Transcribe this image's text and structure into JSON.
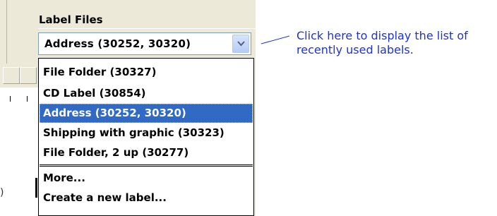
{
  "label_files": {
    "title": "Label Files",
    "current_value": "Address (30252, 30320)"
  },
  "dropdown": {
    "items": [
      "File Folder (30327)",
      "CD Label (30854)",
      "Address (30252, 30320)",
      "Shipping with graphic (30323)",
      "File Folder, 2 up (30277)"
    ],
    "selected_index": 2,
    "actions": [
      "More...",
      "Create a new label..."
    ]
  },
  "callout": {
    "text": "Click here to display the list of recently used labels."
  },
  "colors": {
    "selection": "#316ac5",
    "callout_text": "#1f35c8",
    "panel": "#ece9d8"
  },
  "icons": {
    "dropdown_button": "chevron-down-icon"
  }
}
